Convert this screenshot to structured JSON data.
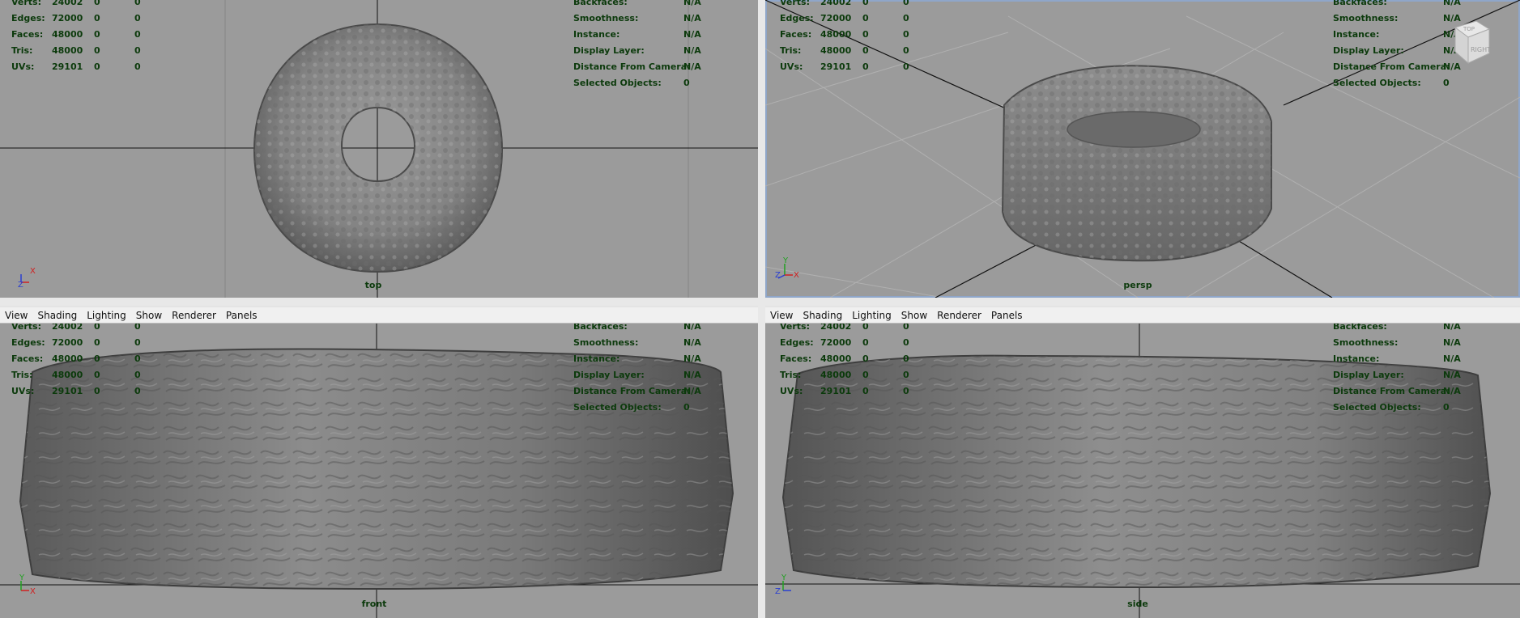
{
  "menu": [
    "View",
    "Shading",
    "Lighting",
    "Show",
    "Renderer",
    "Panels"
  ],
  "hud_left": [
    {
      "label": "Verts:",
      "value": "24002",
      "a": "0",
      "b": "0"
    },
    {
      "label": "Edges:",
      "value": "72000",
      "a": "0",
      "b": "0"
    },
    {
      "label": "Faces:",
      "value": "48000",
      "a": "0",
      "b": "0"
    },
    {
      "label": "Tris:",
      "value": "48000",
      "a": "0",
      "b": "0"
    },
    {
      "label": "UVs:",
      "value": "29101",
      "a": "0",
      "b": "0"
    }
  ],
  "hud_right": [
    {
      "label": "Backfaces:",
      "value": "N/A"
    },
    {
      "label": "Smoothness:",
      "value": "N/A"
    },
    {
      "label": "Instance:",
      "value": "N/A"
    },
    {
      "label": "Display Layer:",
      "value": "N/A"
    },
    {
      "label": "Distance From Camera:",
      "value": "N/A"
    },
    {
      "label": "Selected Objects:",
      "value": "0"
    }
  ],
  "viewports": {
    "top": {
      "camera": "top",
      "axes": [
        "Z",
        "X"
      ]
    },
    "persp": {
      "camera": "persp",
      "axes": [
        "Y",
        "Z",
        "X"
      ],
      "viewcube": [
        "RIGHT",
        "TOP"
      ]
    },
    "front": {
      "camera": "front",
      "axes": [
        "Y",
        "X"
      ]
    },
    "side": {
      "camera": "side",
      "axes": [
        "Y",
        "Z"
      ]
    }
  },
  "colors": {
    "viewport_bg": "#9b9b9b",
    "hud_text": "#0c3a0c",
    "mesh": "#7a7a7a",
    "menubar": "#f0f0f0",
    "active_border": "#8fa6c9"
  }
}
